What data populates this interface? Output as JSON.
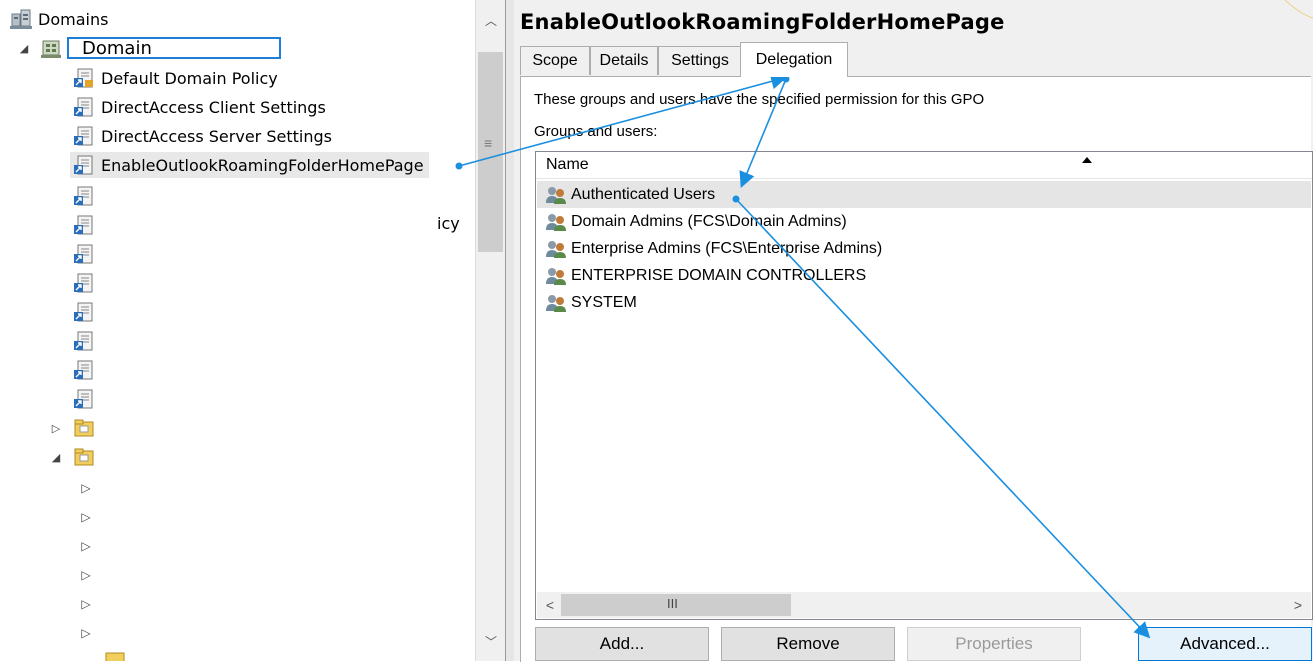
{
  "tree": {
    "root_label": "Domains",
    "domain_label": "Domain",
    "items": [
      {
        "label": "Default Domain Policy"
      },
      {
        "label": "DirectAccess Client Settings"
      },
      {
        "label": "DirectAccess Server Settings"
      },
      {
        "label": "EnableOutlookRoamingFolderHomePage"
      }
    ],
    "partial_text": "icy"
  },
  "gpo": {
    "title": "EnableOutlookRoamingFolderHomePage",
    "tabs": [
      "Scope",
      "Details",
      "Settings",
      "Delegation"
    ],
    "active_tab": "Delegation",
    "description": "These groups and users have the specified permission for this GPO",
    "groups_label": "Groups and users:",
    "column_name": "Name",
    "rows": [
      {
        "name": "Authenticated Users"
      },
      {
        "name": "Domain Admins (FCS\\Domain Admins)"
      },
      {
        "name": "Enterprise Admins (FCS\\Enterprise Admins)"
      },
      {
        "name": "ENTERPRISE DOMAIN CONTROLLERS"
      },
      {
        "name": "SYSTEM"
      }
    ],
    "buttons": {
      "add": "Add...",
      "remove": "Remove",
      "properties": "Properties",
      "advanced": "Advanced..."
    },
    "hscroll_grip": "III"
  },
  "colors": {
    "annotation_arrow": "#1a8fe0",
    "domain_box": "#1e7fd8"
  }
}
